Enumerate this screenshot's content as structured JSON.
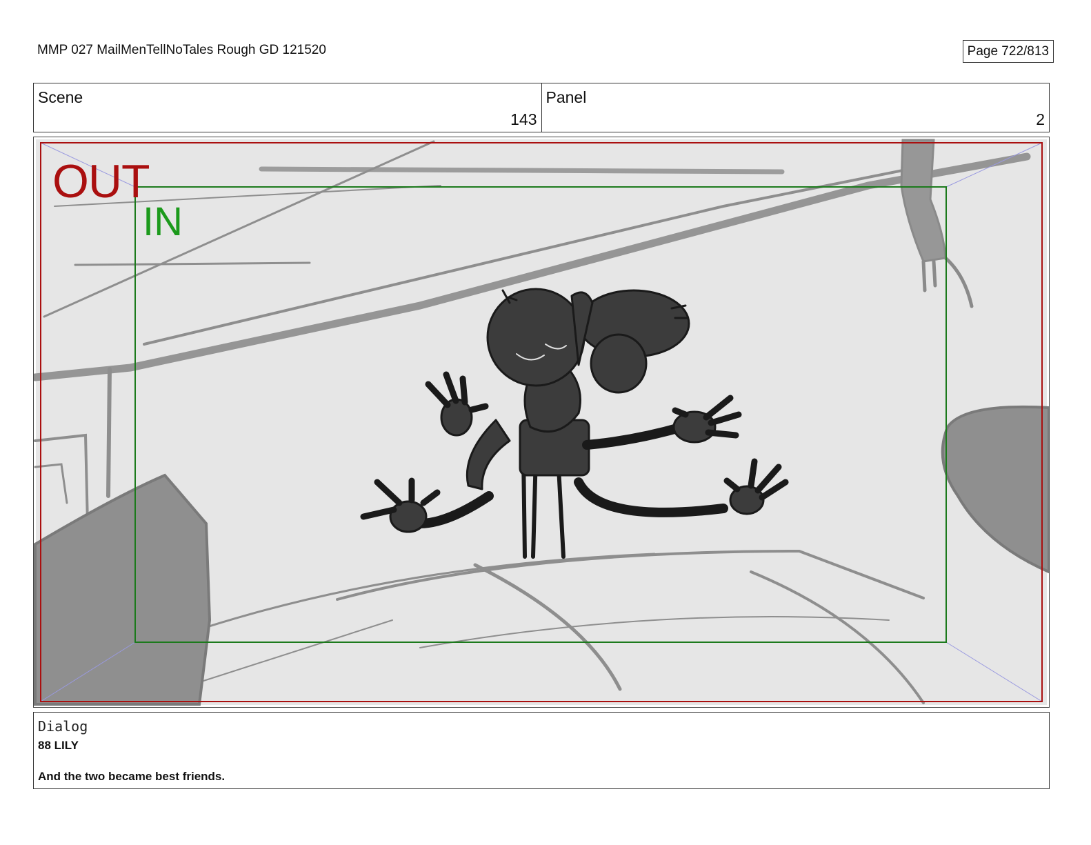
{
  "header": {
    "document_title": "MMP 027 MailMenTellNoTales Rough GD 121520",
    "page_label": "Page 722/813"
  },
  "scene": {
    "label": "Scene",
    "value": "143"
  },
  "panel": {
    "label": "Panel",
    "value": "2"
  },
  "frame": {
    "out_label": "OUT",
    "in_label": "IN",
    "colors": {
      "out": "#aa0f0f",
      "in": "#1c9a1c",
      "guide": "#9a9ae0",
      "sketch": "#8c8c8c",
      "character": "#3a3a3a"
    }
  },
  "dialog": {
    "label": "Dialog",
    "speaker": "88 LILY",
    "line": "And the two became best friends."
  }
}
